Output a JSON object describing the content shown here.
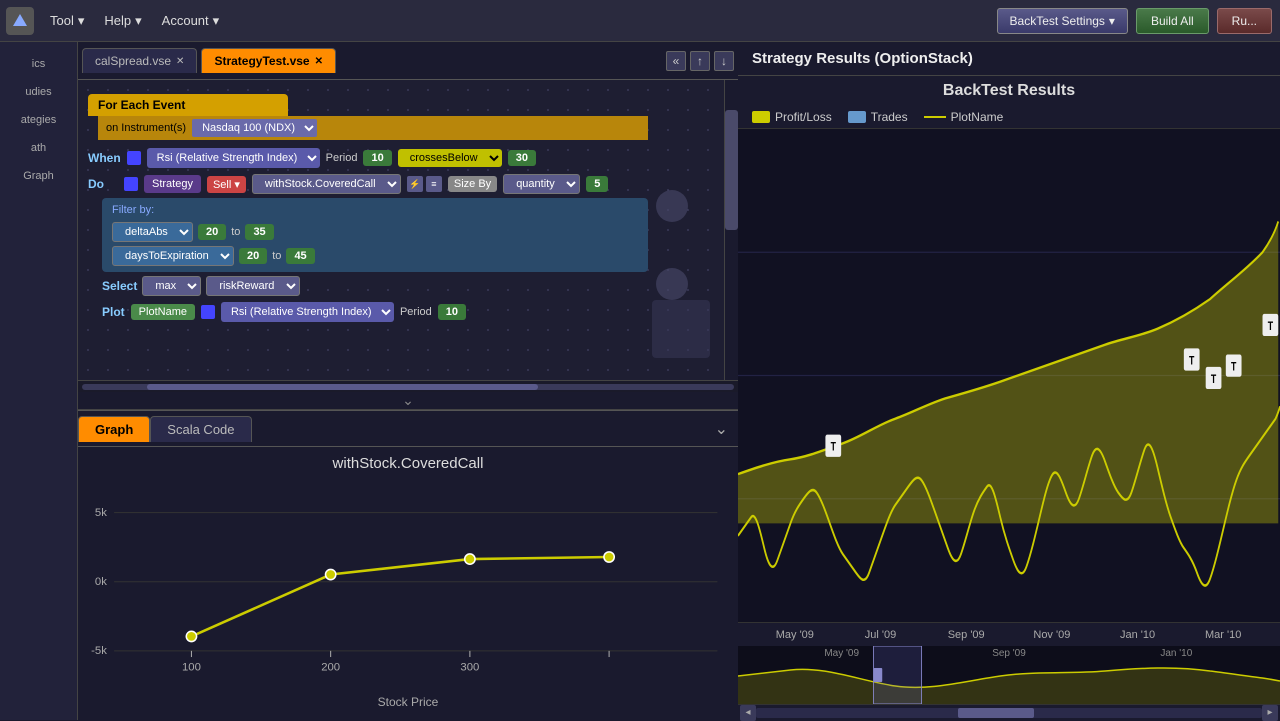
{
  "toolbar": {
    "tool_label": "Tool",
    "help_label": "Help",
    "account_label": "Account",
    "backtest_settings_label": "BackTest Settings",
    "build_all_label": "Build All",
    "run_label": "Ru..."
  },
  "sidebar": {
    "items": [
      {
        "label": "ics",
        "id": "basics"
      },
      {
        "label": "udies",
        "id": "studies"
      },
      {
        "label": "ategies",
        "id": "strategies"
      },
      {
        "label": "ath",
        "id": "math"
      },
      {
        "label": "Graph",
        "id": "graph"
      }
    ]
  },
  "tabs": {
    "tab1": {
      "label": "calSpread.vse",
      "active": false
    },
    "tab2": {
      "label": "StrategyTest.vse",
      "active": true
    }
  },
  "editor": {
    "for_each_event": "For Each Event",
    "on_instruments": "on Instrument(s)",
    "instrument_value": "Nasdaq 100 (NDX)",
    "when_label": "When",
    "rsi_label": "Rsi (Relative Strength Index)",
    "period_label": "Period",
    "period_value": "10",
    "crosses_below": "crossesBelow",
    "crosses_value": "30",
    "do_label": "Do",
    "strategy_label": "Strategy",
    "sell_label": "Sell",
    "with_stock_label": "withStock.CoveredCall",
    "size_by_label": "Size By",
    "quantity_label": "quantity",
    "size_value": "5",
    "filter_label": "Filter by:",
    "delta_abs": "deltaAbs",
    "delta_from": "20",
    "delta_to": "35",
    "dte_label": "daysToExpiration",
    "dte_from": "20",
    "dte_to": "45",
    "select_label": "Select",
    "max_label": "max",
    "risk_reward": "riskReward",
    "plot_label": "Plot",
    "plot_name": "PlotName",
    "plot_rsi": "Rsi (Relative Strength Index)",
    "plot_period": "Period",
    "plot_period_value": "10",
    "to_label": "to"
  },
  "bottom_tabs": {
    "graph_label": "Graph",
    "scala_label": "Scala Code"
  },
  "chart": {
    "title": "withStock.CoveredCall",
    "x_label": "Stock Price",
    "y_labels": [
      "-5k",
      "0k",
      "5k"
    ],
    "x_ticks": [
      "100",
      "200",
      "300"
    ],
    "points": [
      {
        "x": 105,
        "y": 155
      },
      {
        "x": 210,
        "y": 95
      },
      {
        "x": 295,
        "y": 75
      }
    ]
  },
  "right_panel": {
    "title": "Strategy Results (OptionStack)",
    "backtest_title": "BackTest Results",
    "legend": {
      "profit_loss": "Profit/Loss",
      "trades": "Trades",
      "plot_name": "PlotName"
    },
    "timeline_labels": [
      "May '09",
      "Jul '09",
      "Sep '09",
      "Nov '09",
      "Jan '10",
      "Mar '10"
    ],
    "mini_labels": [
      "May '09",
      "Sep '09",
      "Jan '10"
    ],
    "trade_markers": [
      {
        "label": "T",
        "x": 102,
        "y": 255
      },
      {
        "label": "T",
        "x": 520,
        "y": 185
      },
      {
        "label": "T",
        "x": 545,
        "y": 205
      },
      {
        "label": "T",
        "x": 565,
        "y": 195
      },
      {
        "label": "T",
        "x": 605,
        "y": 160
      }
    ]
  },
  "colors": {
    "accent_orange": "#ff8c00",
    "chart_yellow": "#cccc00",
    "trade_marker_bg": "#eeeeee",
    "block_blue": "#5a5aaa",
    "block_green": "#3a7a3a",
    "block_purple": "#5a3a8a",
    "header_bg": "#1a1a2e"
  }
}
